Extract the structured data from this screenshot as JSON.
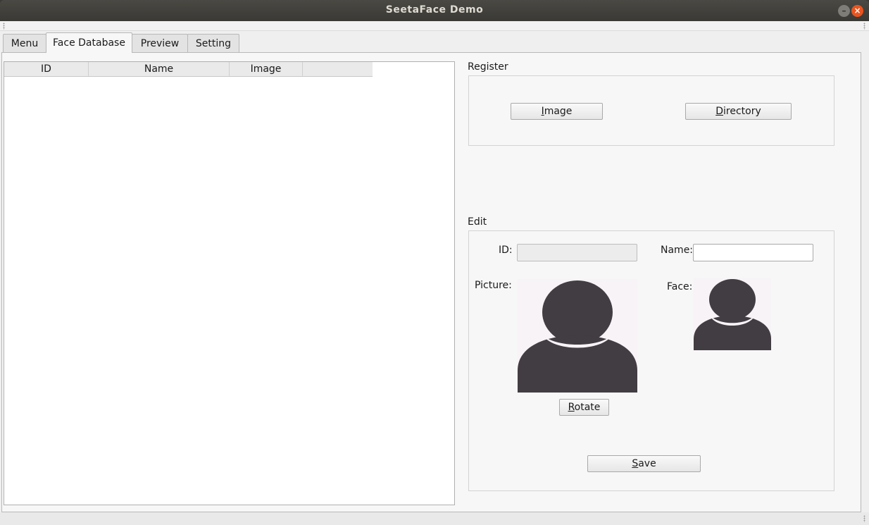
{
  "window": {
    "title": "SeetaFace Demo",
    "minimize_glyph": "–",
    "close_glyph": "×"
  },
  "tabs": [
    {
      "label": "Menu"
    },
    {
      "label": "Face Database"
    },
    {
      "label": "Preview"
    },
    {
      "label": "Setting"
    }
  ],
  "active_tab": "Face Database",
  "table": {
    "columns": [
      "ID",
      "Name",
      "Image"
    ],
    "rows": []
  },
  "register": {
    "title": "Register",
    "image_button": {
      "mnemonic": "I",
      "rest": "mage"
    },
    "directory_button": {
      "mnemonic": "D",
      "rest": "irectory"
    }
  },
  "edit": {
    "title": "Edit",
    "id_label": "ID:",
    "id_value": "",
    "name_label": "Name:",
    "name_value": "",
    "picture_label": "Picture:",
    "face_label": "Face:",
    "rotate_button": {
      "mnemonic": "R",
      "rest": "otate"
    },
    "save_button": {
      "mnemonic": "S",
      "rest": "ave"
    }
  },
  "colors": {
    "avatar_fg": "#423d42",
    "avatar_bg": "#f7f3f7",
    "close_button": "#e9541f"
  },
  "icons": {
    "picture_placeholder": "person-silhouette-icon",
    "face_placeholder": "person-silhouette-icon"
  }
}
